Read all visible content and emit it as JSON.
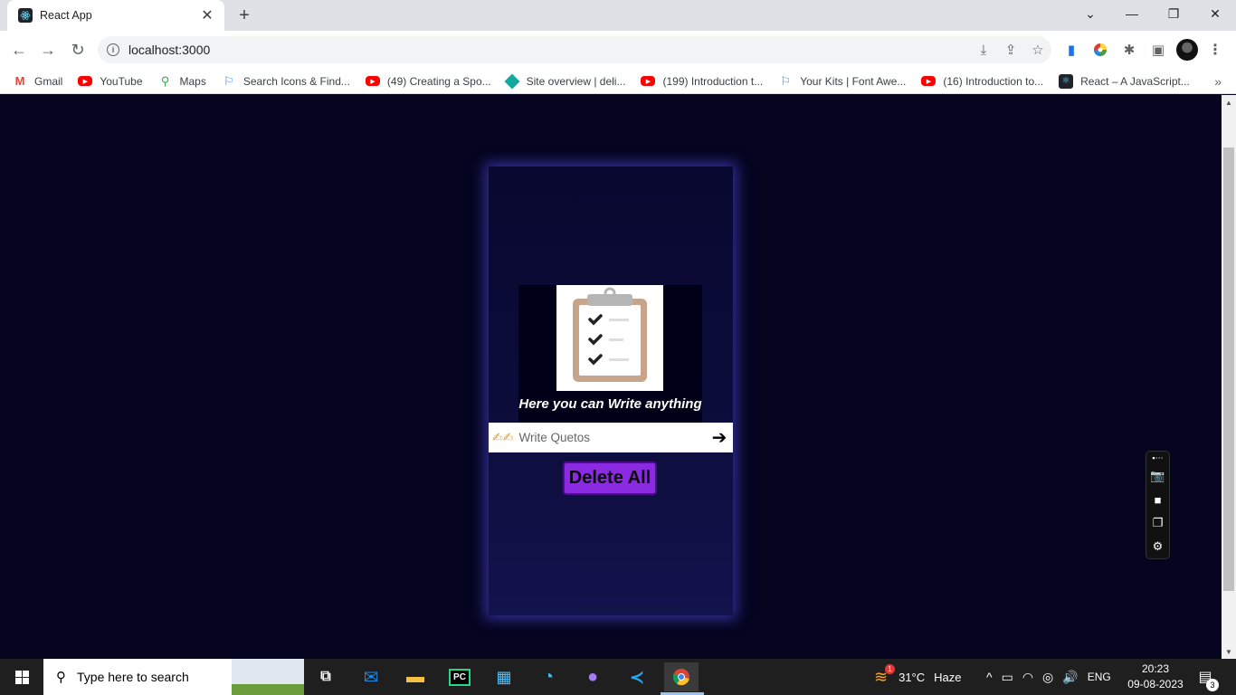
{
  "browser": {
    "tab_title": "React App",
    "url": "localhost:3000",
    "bookmarks": [
      {
        "label": "Gmail",
        "icon": "gmail-icon"
      },
      {
        "label": "YouTube",
        "icon": "youtube-icon"
      },
      {
        "label": "Maps",
        "icon": "maps-icon"
      },
      {
        "label": "Search Icons & Find...",
        "icon": "flag-icon"
      },
      {
        "label": "(49) Creating a Spo...",
        "icon": "youtube-icon"
      },
      {
        "label": "Site overview | deli...",
        "icon": "diamond-icon"
      },
      {
        "label": "(199) Introduction t...",
        "icon": "youtube-icon"
      },
      {
        "label": "Your Kits | Font Awe...",
        "icon": "flag-icon"
      },
      {
        "label": "(16) Introduction to...",
        "icon": "youtube-icon"
      },
      {
        "label": "React – A JavaScript...",
        "icon": "react-icon"
      }
    ]
  },
  "app": {
    "tagline": "Here you can Write anything",
    "input": {
      "placeholder": "Write Quetos",
      "value": "",
      "emoji": "✍✍"
    },
    "delete_all_label": "Delete All"
  },
  "taskbar": {
    "search_placeholder": "Type here to search",
    "weather": {
      "temp": "31°C",
      "condition": "Haze",
      "badge": "1"
    },
    "language": "ENG",
    "time": "20:23",
    "date": "09-08-2023",
    "notification_count": "3"
  },
  "colors": {
    "page_bg": "#050520",
    "card_glow": "#5a50ff",
    "button_bg": "#8a2be2"
  }
}
